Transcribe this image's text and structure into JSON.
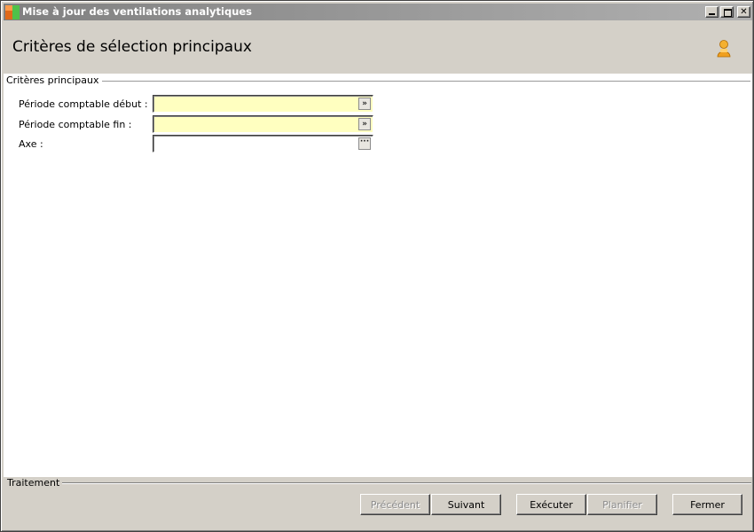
{
  "window": {
    "title": "Mise à jour des ventilations analytiques",
    "icon": "app-icon"
  },
  "header": {
    "title": "Critères de sélection principaux",
    "user_icon": "user-icon"
  },
  "criteria": {
    "group_label": "Critères principaux",
    "fields": [
      {
        "label": "Période comptable début :",
        "value": "",
        "control": "dropdown"
      },
      {
        "label": "Période comptable fin :",
        "value": "",
        "control": "dropdown"
      },
      {
        "label": "Axe :",
        "value": "",
        "control": "lookup"
      }
    ]
  },
  "treatment": {
    "group_label": "Traitement"
  },
  "buttons": {
    "previous": "Précédent",
    "next": "Suivant",
    "execute": "Exécuter",
    "schedule": "Planifier",
    "close": "Fermer"
  },
  "colors": {
    "required_field_bg": "#ffffc0",
    "window_bg": "#d4d0c8",
    "user_icon": "#f0a020"
  }
}
